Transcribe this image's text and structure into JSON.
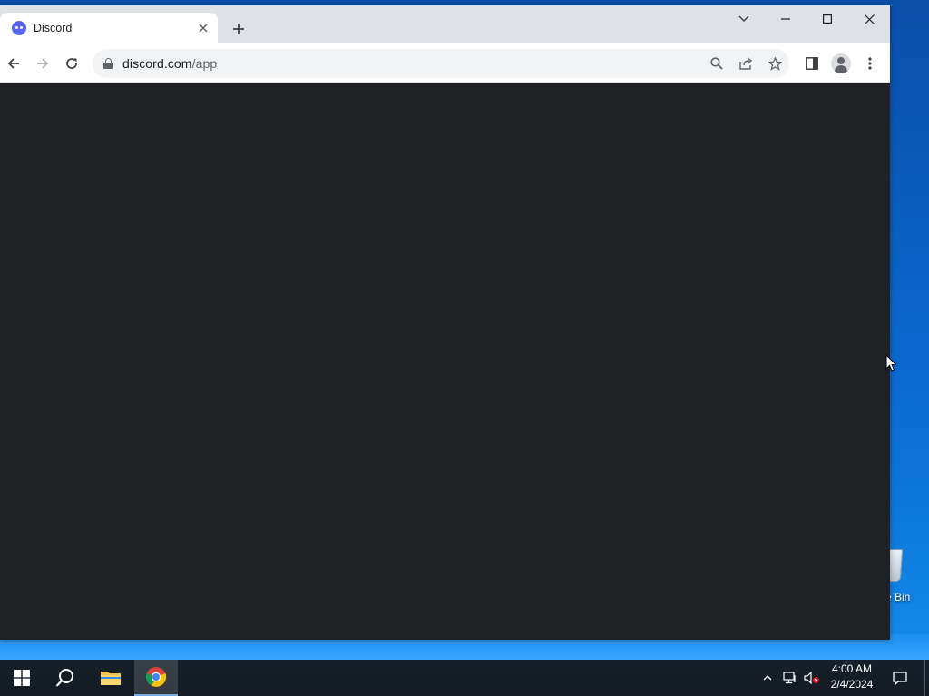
{
  "browser": {
    "tab": {
      "title": "Discord",
      "favicon": "discord-icon"
    },
    "url": {
      "domain": "discord.com",
      "path": "/app"
    },
    "page_background": "#202124"
  },
  "desktop": {
    "recycle_bin_label": "e Bin"
  },
  "taskbar": {
    "clock_time": "4:00 AM",
    "clock_date": "2/4/2024",
    "pinned": [
      "start",
      "search",
      "file-explorer",
      "chrome"
    ]
  }
}
